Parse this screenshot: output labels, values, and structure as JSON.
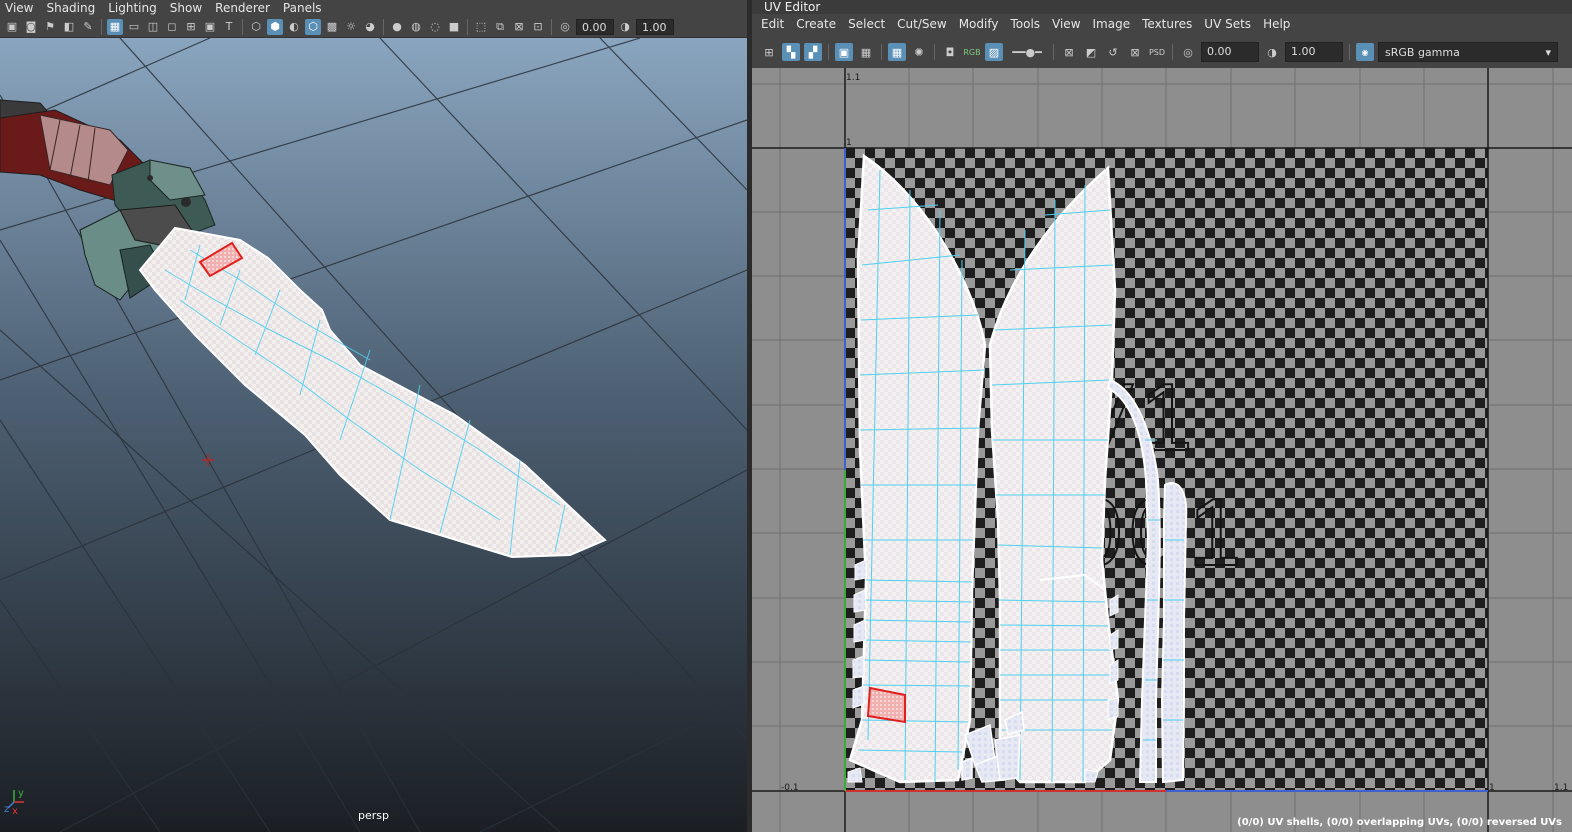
{
  "viewport": {
    "menu": [
      "View",
      "Shading",
      "Lighting",
      "Show",
      "Renderer",
      "Panels"
    ],
    "exposure_value": "0.00",
    "gamma_value": "1.00",
    "camera_label": "persp",
    "axis_labels": {
      "x": "x",
      "y": "y",
      "z": "z"
    }
  },
  "uv_editor": {
    "title": "UV Editor",
    "menu": [
      "Edit",
      "Create",
      "Select",
      "Cut/Sew",
      "Modify",
      "Tools",
      "View",
      "Image",
      "Textures",
      "UV Sets",
      "Help"
    ],
    "exposure_value": "0.00",
    "gamma_value": "1.00",
    "rgb_label": "RGB",
    "psd_label": "PSD",
    "colorspace": "sRGB gamma",
    "tile_label_line1": "1V1",
    "tile_label_line2": "1001",
    "grid_labels": {
      "top": "1.1",
      "one": "1",
      "minus": "-0.1",
      "right_one": "1",
      "right_top": "1.1"
    },
    "status": "(0/0) UV shells, (0/0) overlapping UVs, (0/0) reversed UVs"
  },
  "colors": {
    "selection": "#e0201d",
    "wire": "#4fd0f0",
    "shell_border": "#ffffff",
    "accent": "#5a8fb6"
  }
}
